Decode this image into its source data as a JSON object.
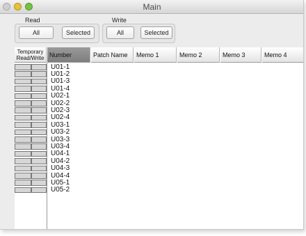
{
  "window": {
    "title": "Main"
  },
  "read": {
    "label": "Read",
    "all_label": "All",
    "selected_label": "Selected"
  },
  "write": {
    "label": "Write",
    "all_label": "All",
    "selected_label": "Selected"
  },
  "table": {
    "temp_header_line1": "Temporary",
    "temp_header_line2": "Read/Write",
    "columns": [
      "Number",
      "Patch Name",
      "Memo 1",
      "Memo 2",
      "Memo 3",
      "Memo 4"
    ],
    "selected_column": "Number",
    "rows": [
      "U01-1",
      "U01-2",
      "U01-3",
      "U01-4",
      "U02-1",
      "U02-2",
      "U02-3",
      "U02-4",
      "U03-1",
      "U03-2",
      "U03-3",
      "U03-4",
      "U04-1",
      "U04-2",
      "U04-3",
      "U04-4",
      "U05-1",
      "U05-2"
    ]
  }
}
